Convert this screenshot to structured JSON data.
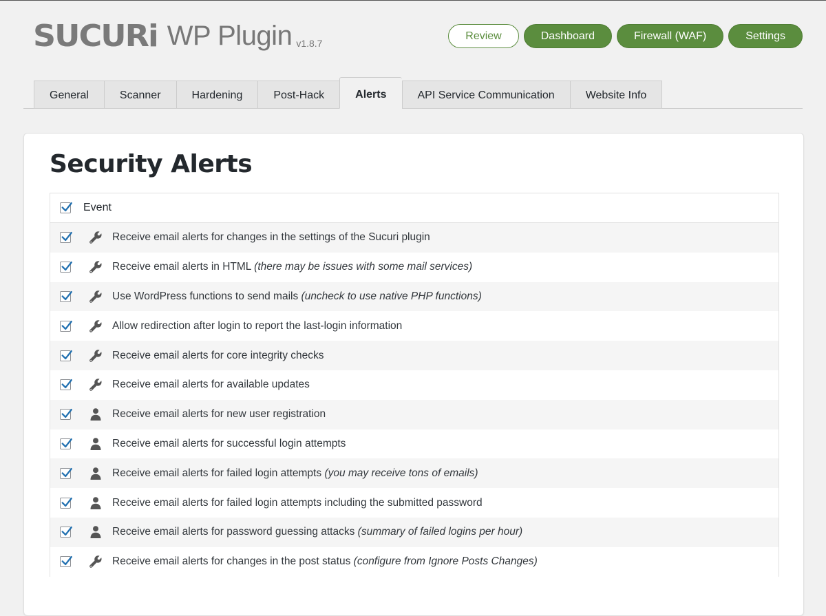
{
  "header": {
    "brand": "SUCURi",
    "product": "WP Plugin",
    "version": "v1.8.7",
    "nav": [
      {
        "label": "Review",
        "style": "outline"
      },
      {
        "label": "Dashboard",
        "style": "solid"
      },
      {
        "label": "Firewall (WAF)",
        "style": "solid"
      },
      {
        "label": "Settings",
        "style": "solid"
      }
    ]
  },
  "tabs": [
    {
      "label": "General",
      "active": false
    },
    {
      "label": "Scanner",
      "active": false
    },
    {
      "label": "Hardening",
      "active": false
    },
    {
      "label": "Post-Hack",
      "active": false
    },
    {
      "label": "Alerts",
      "active": true
    },
    {
      "label": "API Service Communication",
      "active": false
    },
    {
      "label": "Website Info",
      "active": false
    }
  ],
  "panel": {
    "title": "Security Alerts",
    "header_label": "Event",
    "header_checked": true,
    "rows": [
      {
        "icon": "wrench-icon",
        "checked": true,
        "text": "Receive email alerts for changes in the settings of the Sucuri plugin",
        "note": ""
      },
      {
        "icon": "wrench-icon",
        "checked": true,
        "text": "Receive email alerts in HTML",
        "note": "(there may be issues with some mail services)"
      },
      {
        "icon": "wrench-icon",
        "checked": true,
        "text": "Use WordPress functions to send mails",
        "note": "(uncheck to use native PHP functions)"
      },
      {
        "icon": "wrench-icon",
        "checked": true,
        "text": "Allow redirection after login to report the last-login information",
        "note": ""
      },
      {
        "icon": "wrench-icon",
        "checked": true,
        "text": "Receive email alerts for core integrity checks",
        "note": ""
      },
      {
        "icon": "wrench-icon",
        "checked": true,
        "text": "Receive email alerts for available updates",
        "note": ""
      },
      {
        "icon": "user-icon",
        "checked": true,
        "text": "Receive email alerts for new user registration",
        "note": ""
      },
      {
        "icon": "user-icon",
        "checked": true,
        "text": "Receive email alerts for successful login attempts",
        "note": ""
      },
      {
        "icon": "user-icon",
        "checked": true,
        "text": "Receive email alerts for failed login attempts",
        "note": "(you may receive tons of emails)"
      },
      {
        "icon": "user-icon",
        "checked": true,
        "text": "Receive email alerts for failed login attempts including the submitted password",
        "note": ""
      },
      {
        "icon": "user-icon",
        "checked": true,
        "text": "Receive email alerts for password guessing attacks",
        "note": "(summary of failed logins per hour)"
      },
      {
        "icon": "wrench-icon",
        "checked": true,
        "text": "Receive email alerts for changes in the post status",
        "note": "(configure from Ignore Posts Changes)"
      }
    ]
  },
  "colors": {
    "accent": "#5b8d3e",
    "check": "#2271b1",
    "icon": "#555555"
  }
}
